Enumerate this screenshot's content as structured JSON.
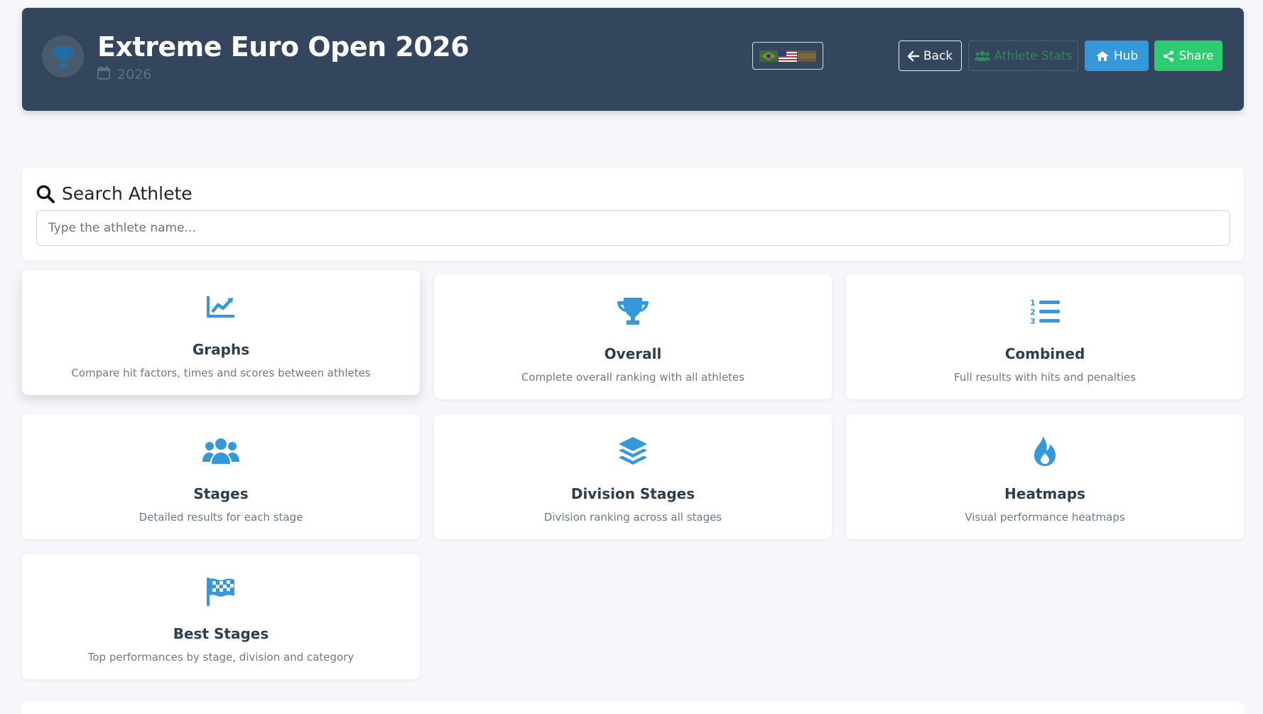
{
  "header": {
    "title": "Extreme Euro Open 2026",
    "year": "2026",
    "buttons": {
      "back": "Back",
      "athlete_stats": "Athlete Stats",
      "hub": "Hub",
      "share": "Share"
    }
  },
  "search": {
    "title": "Search Athlete",
    "placeholder": "Type the athlete name..."
  },
  "cards": [
    {
      "title": "Graphs",
      "description": "Compare hit factors, times and scores between athletes",
      "icon": "chart-line-icon"
    },
    {
      "title": "Overall",
      "description": "Complete overall ranking with all athletes",
      "icon": "trophy-icon"
    },
    {
      "title": "Combined",
      "description": "Full results with hits and penalties",
      "icon": "list-ol-icon"
    },
    {
      "title": "Stages",
      "description": "Detailed results for each stage",
      "icon": "users-icon"
    },
    {
      "title": "Division Stages",
      "description": "Division ranking across all stages",
      "icon": "layer-group-icon"
    },
    {
      "title": "Heatmaps",
      "description": "Visual performance heatmaps",
      "icon": "fire-icon"
    },
    {
      "title": "Best Stages",
      "description": "Top performances by stage, division and category",
      "icon": "flag-checkered-icon"
    }
  ],
  "colors": {
    "header_bg": "#34465d",
    "accent_blue": "#3498db",
    "accent_green": "#2ecc71",
    "page_bg": "#f5f7fa"
  }
}
